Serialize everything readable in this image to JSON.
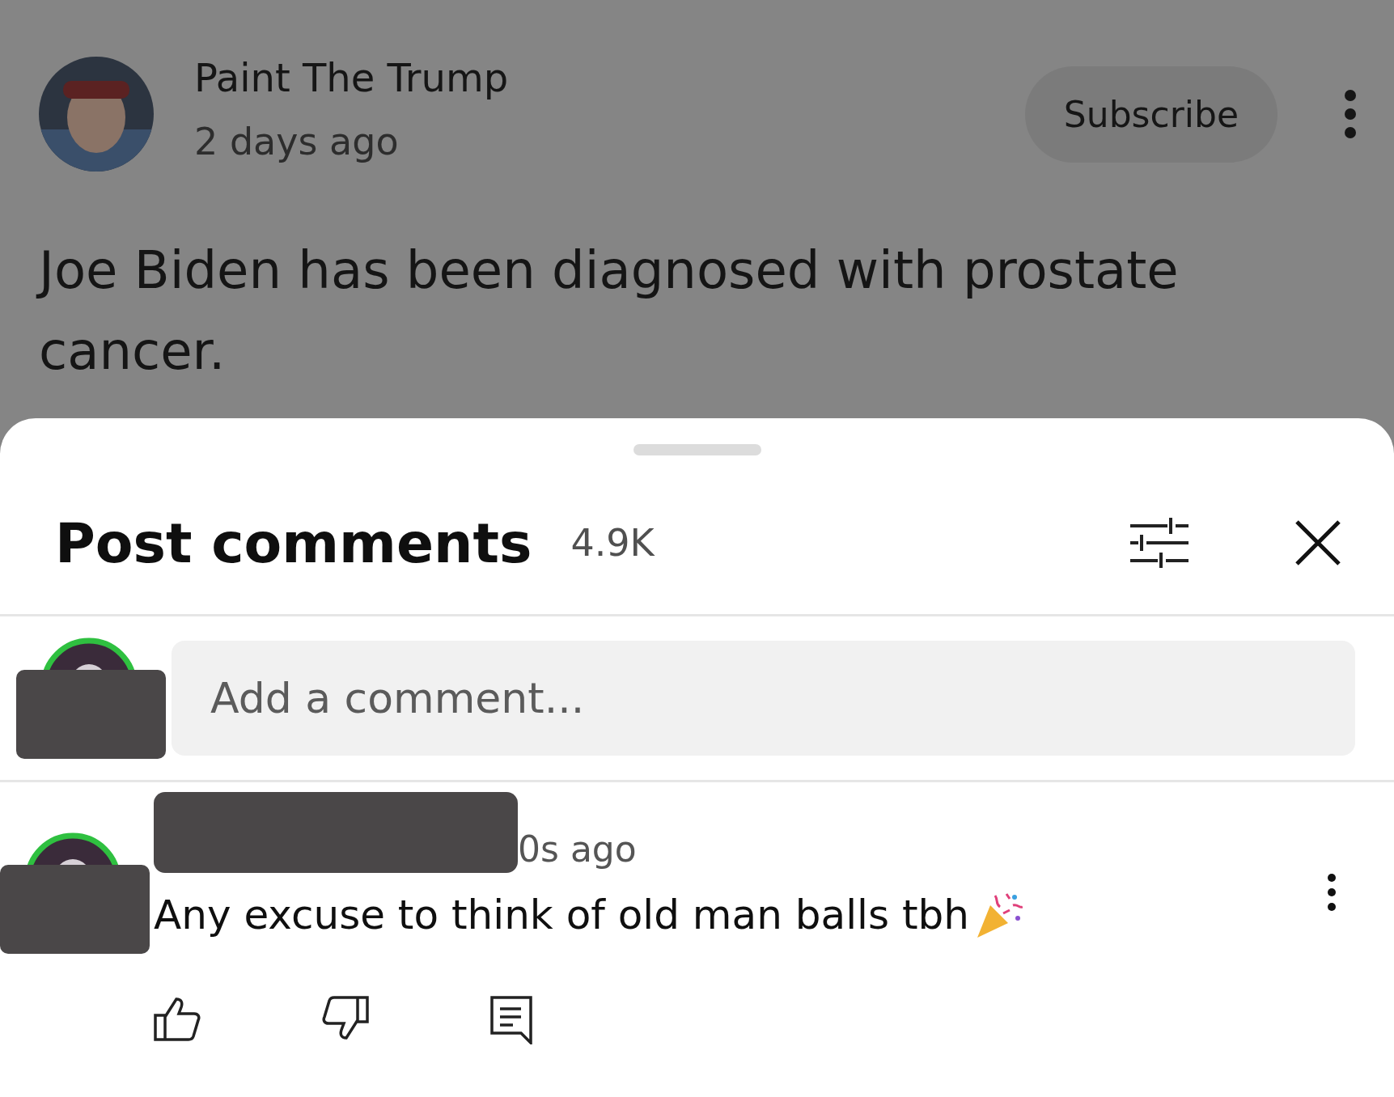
{
  "post": {
    "channel": "Paint The Trump",
    "time": "2 days ago",
    "subscribe": "Subscribe",
    "text": "Joe Biden has been diagnosed with prostate cancer."
  },
  "sheet": {
    "title": "Post comments",
    "count": "4.9K",
    "input": {
      "placeholder": "Add a comment..."
    }
  },
  "comments": [
    {
      "time": "0s ago",
      "text": "Any excuse to think of old man balls tbh"
    }
  ]
}
